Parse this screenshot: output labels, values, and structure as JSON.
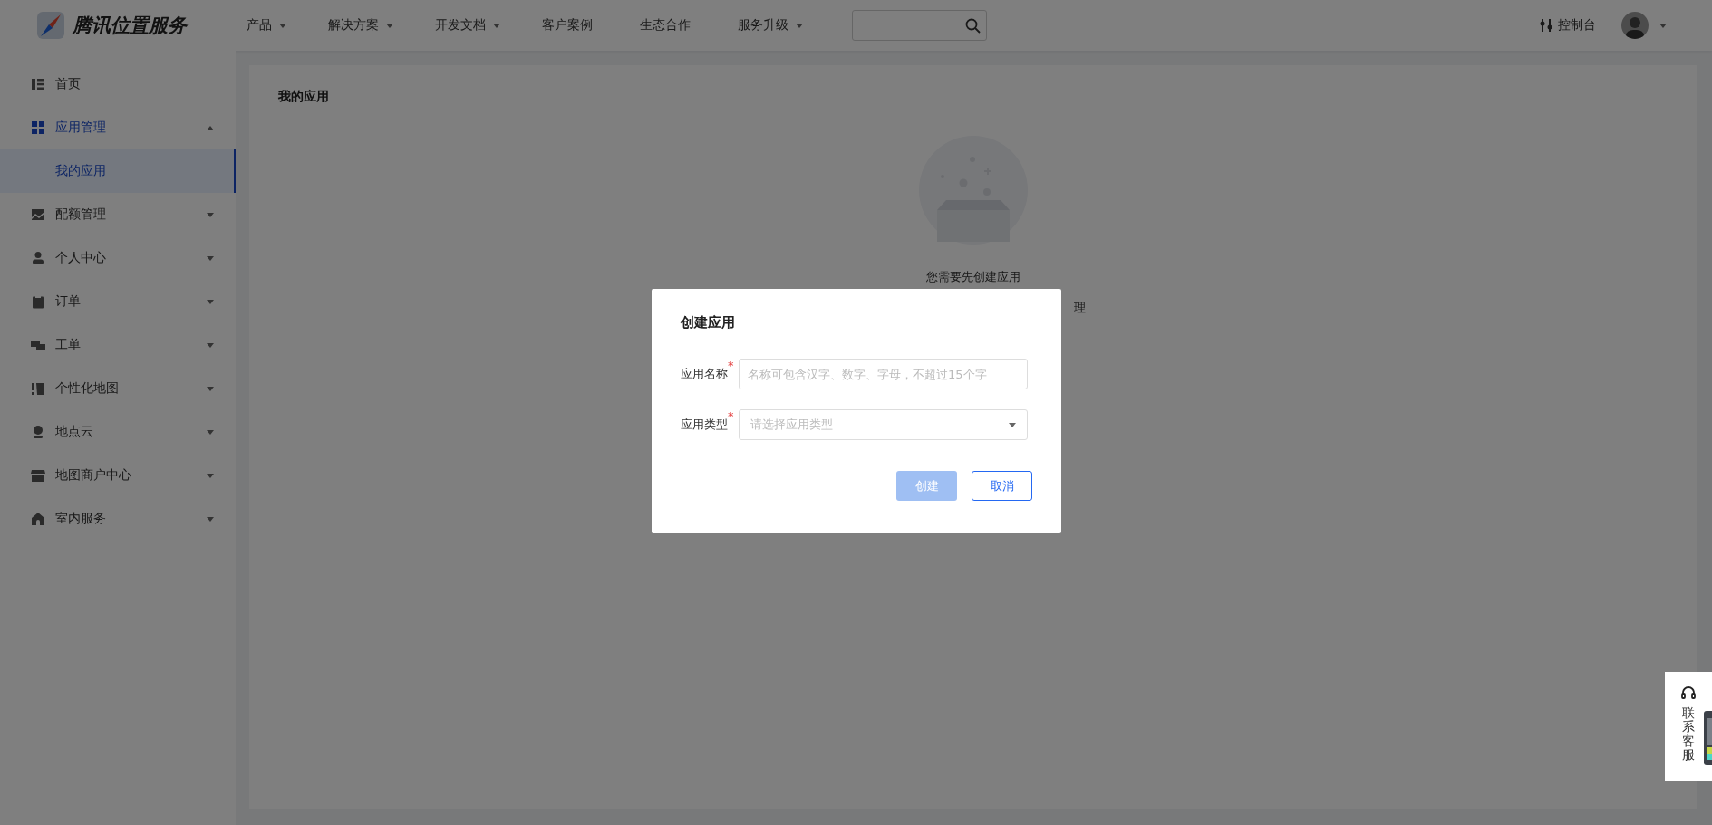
{
  "header": {
    "brand": "腾讯位置服务",
    "nav": [
      {
        "label": "产品",
        "dropdown": true
      },
      {
        "label": "解决方案",
        "dropdown": true
      },
      {
        "label": "开发文档",
        "dropdown": true
      },
      {
        "label": "客户案例",
        "dropdown": false
      },
      {
        "label": "生态合作",
        "dropdown": false
      },
      {
        "label": "服务升级",
        "dropdown": true
      }
    ],
    "console": "控制台"
  },
  "sidebar": {
    "items": [
      {
        "label": "首页",
        "active": false
      },
      {
        "label": "应用管理",
        "active": true,
        "expanded": true,
        "children": [
          {
            "label": "我的应用",
            "selected": true
          }
        ]
      },
      {
        "label": "配额管理",
        "active": false,
        "expanded": false
      },
      {
        "label": "个人中心",
        "active": false,
        "expanded": false
      },
      {
        "label": "订单",
        "active": false,
        "expanded": false
      },
      {
        "label": "工单",
        "active": false,
        "expanded": false
      },
      {
        "label": "个性化地图",
        "active": false,
        "expanded": false
      },
      {
        "label": "地点云",
        "active": false,
        "expanded": false
      },
      {
        "label": "地图商户中心",
        "active": false,
        "expanded": false
      },
      {
        "label": "室内服务",
        "active": false,
        "expanded": false
      }
    ]
  },
  "content": {
    "title": "我的应用",
    "empty_state": {
      "message": "您需要先创建应用",
      "line_2": "理"
    }
  },
  "dialog": {
    "title": "创建应用",
    "fields": [
      {
        "kind": "input",
        "label": "应用名称",
        "required": true,
        "required_mark": "*",
        "placeholder": "名称可包含汉字、数字、字母，不超过15个字"
      },
      {
        "kind": "select",
        "label": "应用类型",
        "required": true,
        "required_mark": "*",
        "placeholder": "请选择应用类型"
      }
    ],
    "buttons": [
      {
        "kind": "primary",
        "label": "创建",
        "disabled": true
      },
      {
        "kind": "default",
        "label": "取消",
        "disabled": false
      }
    ]
  },
  "contact": {
    "label": "联系客服"
  }
}
